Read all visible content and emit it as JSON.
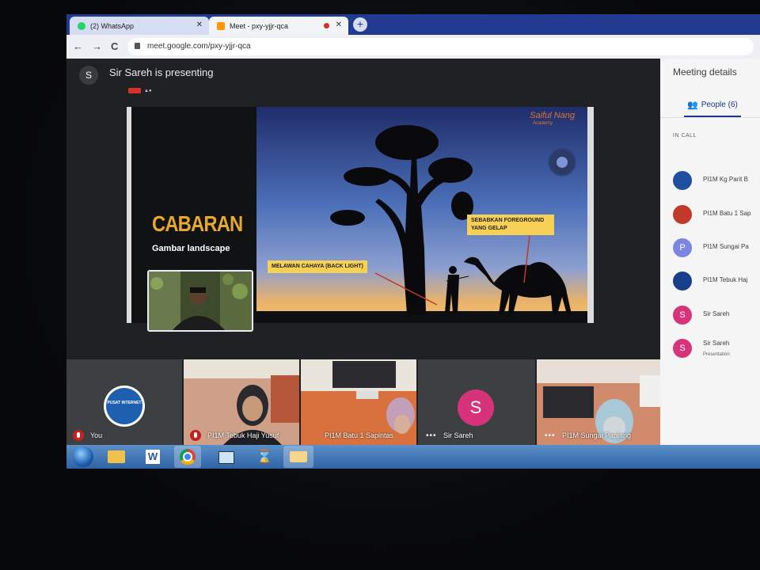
{
  "browser": {
    "tabs": [
      {
        "label": "(2) WhatsApp",
        "close": "✕"
      },
      {
        "label": "Meet - pxy-yjjr-qca",
        "close": "✕"
      }
    ],
    "new_tab": "+",
    "url": "meet.google.com/pxy-yjjr-qca",
    "nav": {
      "back": "←",
      "forward": "→",
      "reload": "C"
    }
  },
  "meet": {
    "presenter_avatar": "S",
    "presenting_text": "Sir Sareh is presenting",
    "slide": {
      "title": "CABARAN",
      "subtitle": "Gambar landscape",
      "brand": "Saiful Nang",
      "brand_sub": "Academy",
      "label_foreground": "SEBABKAN FOREGROUND YANG GELAP",
      "label_backlight": "MELAWAN CAHAYA (BACK LIGHT)"
    },
    "tiles": [
      {
        "name": "You",
        "logo_text": "PUSAT INTERNET"
      },
      {
        "name": "PI1M Tebuk Haji Yusuf"
      },
      {
        "name": "PI1M Batu 1 Sapintas"
      },
      {
        "name": "Sir Sareh",
        "avatar": "S"
      },
      {
        "name": "PI1M Sungai Panjang"
      }
    ]
  },
  "panel": {
    "title": "Meeting details",
    "people_tab": "People (6)",
    "in_call": "IN CALL",
    "people": [
      {
        "name": "PI1M Kg Parit B",
        "color": "#1f4fa0"
      },
      {
        "name": "PI1M Batu 1 Sap",
        "color": "#c0392b"
      },
      {
        "name": "PI1M Sungai Pa",
        "avatar": "P",
        "color": "#7b86e0"
      },
      {
        "name": "PI1M Tebuk Haj",
        "color": "#1a3f8a"
      },
      {
        "name": "Sir Sareh",
        "avatar": "S",
        "color": "#d6337a"
      },
      {
        "name": "Sir Sareh",
        "avatar": "S",
        "sub": "Presentation",
        "color": "#d6337a"
      }
    ]
  },
  "colors": {
    "tabstrip": "#223a8f",
    "meet_bg": "#202124",
    "accent_title": "#e8a82e",
    "avatar_pink": "#d6337a",
    "mic_muted": "#c5221f"
  }
}
